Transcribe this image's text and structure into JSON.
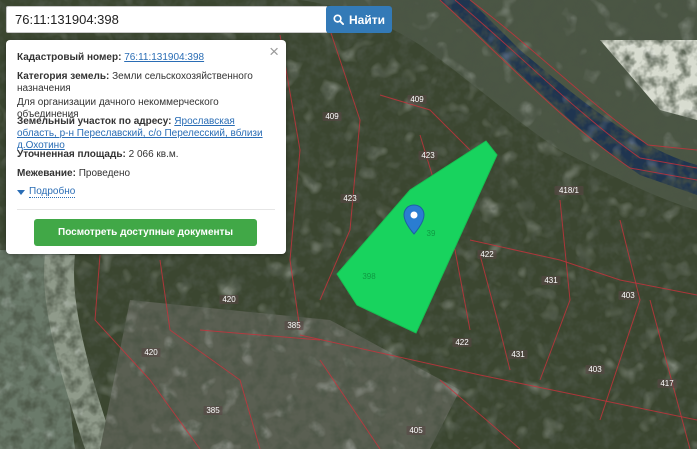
{
  "search": {
    "value": "76:11:131904:398",
    "button_label": "Найти"
  },
  "popup": {
    "cadastral_label": "Кадастровый номер:",
    "cadastral_value": "76:11:131904:398",
    "category_label": "Категория земель:",
    "category_value": "Земли сельскохозяйственного назначения",
    "purpose": "Для организации дачного некоммерческого объединения",
    "address_label": "Земельный участок по адресу:",
    "address_value": "Ярославская область, р-н Переславский, с/о Перелесский, вблизи д.Охотино",
    "area_label": "Уточненная площадь:",
    "area_value": "2 066 кв.м.",
    "survey_label": "Межевание:",
    "survey_value": "Проведено",
    "more_label": "Подробно",
    "docs_button": "Посмотреть доступные документы",
    "close_label": "×"
  },
  "parcel_labels": [
    "409",
    "409",
    "423",
    "423",
    "418/1",
    "422",
    "431",
    "403",
    "420",
    "385",
    "420",
    "422",
    "431",
    "403",
    "417",
    "385",
    "405"
  ],
  "selected_parcel_label": "398",
  "colors": {
    "parcel_fill": "#18d35e",
    "boundary": "#c8323c",
    "search_button": "#337ab7",
    "docs_button": "#41a847"
  }
}
